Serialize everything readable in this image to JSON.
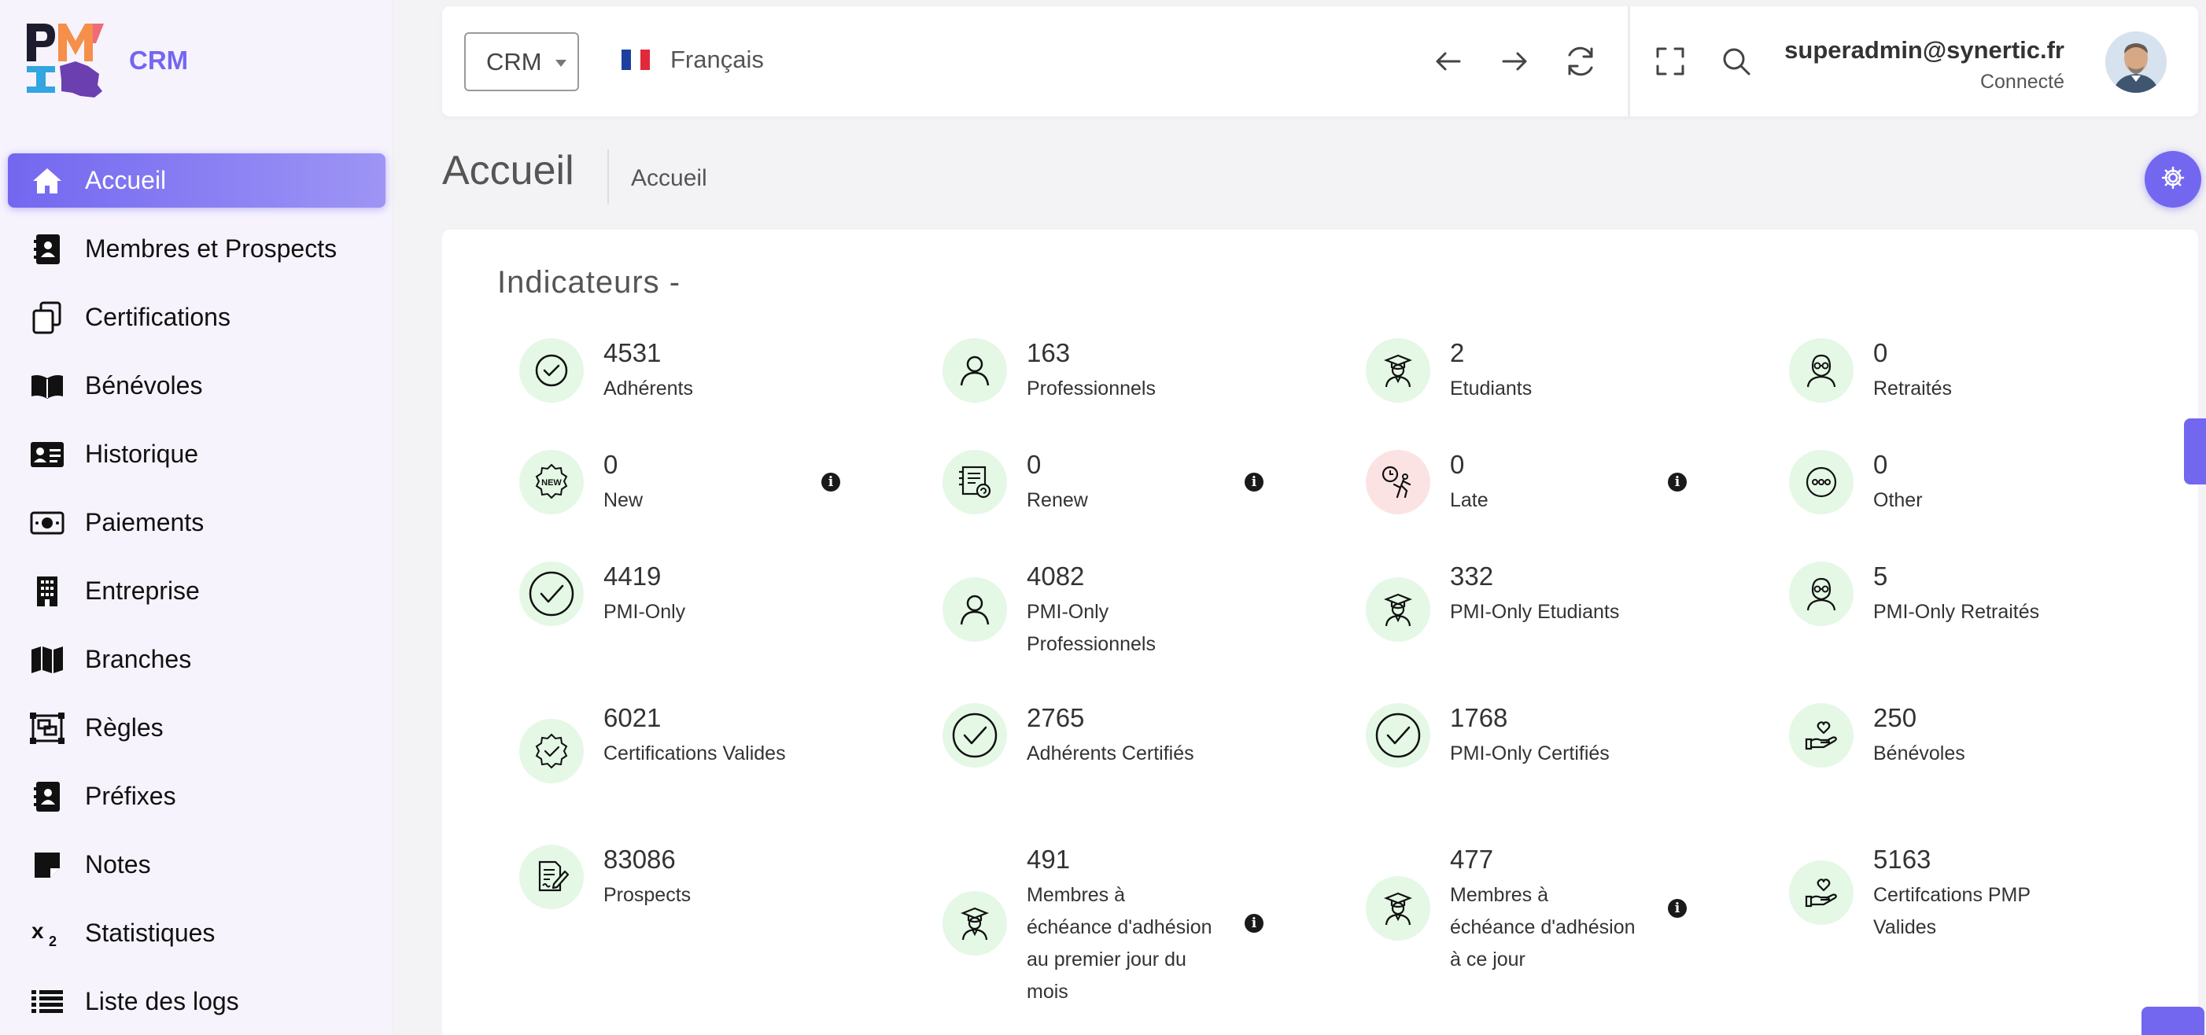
{
  "app": {
    "logo_text": "CRM"
  },
  "sidebar": {
    "items": [
      {
        "label": "Accueil",
        "icon": "home-icon"
      },
      {
        "label": "Membres et Prospects",
        "icon": "contact-book-icon"
      },
      {
        "label": "Certifications",
        "icon": "copy-docs-icon"
      },
      {
        "label": "Bénévoles",
        "icon": "open-book-icon"
      },
      {
        "label": "Historique",
        "icon": "id-card-icon"
      },
      {
        "label": "Paiements",
        "icon": "money-bill-icon"
      },
      {
        "label": "Entreprise",
        "icon": "building-icon"
      },
      {
        "label": "Branches",
        "icon": "map-icon"
      },
      {
        "label": "Règles",
        "icon": "object-group-icon"
      },
      {
        "label": "Préfixes",
        "icon": "address-book-icon"
      },
      {
        "label": "Notes",
        "icon": "sticky-note-icon"
      },
      {
        "label": "Statistiques",
        "icon": "subscript-icon"
      },
      {
        "label": "Liste des logs",
        "icon": "list-icon"
      }
    ]
  },
  "topbar": {
    "app_select": "CRM",
    "language": "Français",
    "user_email": "superadmin@synertic.fr",
    "user_status": "Connecté"
  },
  "page": {
    "title": "Accueil",
    "breadcrumb": "Accueil"
  },
  "card": {
    "title": "Indicateurs -",
    "stats": [
      {
        "value": "4531",
        "label": "Adhérents",
        "icon": "check-circle-icon"
      },
      {
        "value": "163",
        "label": "Professionnels",
        "icon": "user-icon"
      },
      {
        "value": "2",
        "label": "Etudiants",
        "icon": "graduate-icon"
      },
      {
        "value": "0",
        "label": "Retraités",
        "icon": "elderly-icon"
      },
      {
        "value": "0",
        "label": "New",
        "icon": "new-badge-icon"
      },
      {
        "value": "0",
        "label": "Renew",
        "icon": "renew-icon"
      },
      {
        "value": "0",
        "label": "Late",
        "icon": "late-icon"
      },
      {
        "value": "0",
        "label": "Other",
        "icon": "more-icon"
      },
      {
        "value": "4419",
        "label": "PMI-Only",
        "icon": "check-circle-icon"
      },
      {
        "value": "4082",
        "label": "PMI-Only Professionnels",
        "icon": "user-icon"
      },
      {
        "value": "332",
        "label": "PMI-Only Etudiants",
        "icon": "graduate-icon"
      },
      {
        "value": "5",
        "label": "PMI-Only Retraités",
        "icon": "elderly-icon"
      },
      {
        "value": "6021",
        "label": "Certifications Valides",
        "icon": "verified-badge-icon"
      },
      {
        "value": "2765",
        "label": "Adhérents Certifiés",
        "icon": "check-circle-icon"
      },
      {
        "value": "1768",
        "label": "PMI-Only Certifiés",
        "icon": "check-circle-icon"
      },
      {
        "value": "250",
        "label": "Bénévoles",
        "icon": "heart-hand-icon"
      },
      {
        "value": "83086",
        "label": "Prospects",
        "icon": "document-edit-icon"
      },
      {
        "value": "491",
        "label": "Membres à échéance d'adhésion au premier jour du mois",
        "icon": "graduate-icon"
      },
      {
        "value": "477",
        "label": "Membres à échéance d'adhésion à ce jour",
        "icon": "graduate-icon"
      },
      {
        "value": "5163",
        "label": "Certifcations PMP Valides",
        "icon": "heart-hand-icon"
      }
    ]
  },
  "colors": {
    "accent": "#7367f0",
    "stat_bg": "#e4f8e5",
    "stat_bg_red": "#fbe3e4"
  }
}
